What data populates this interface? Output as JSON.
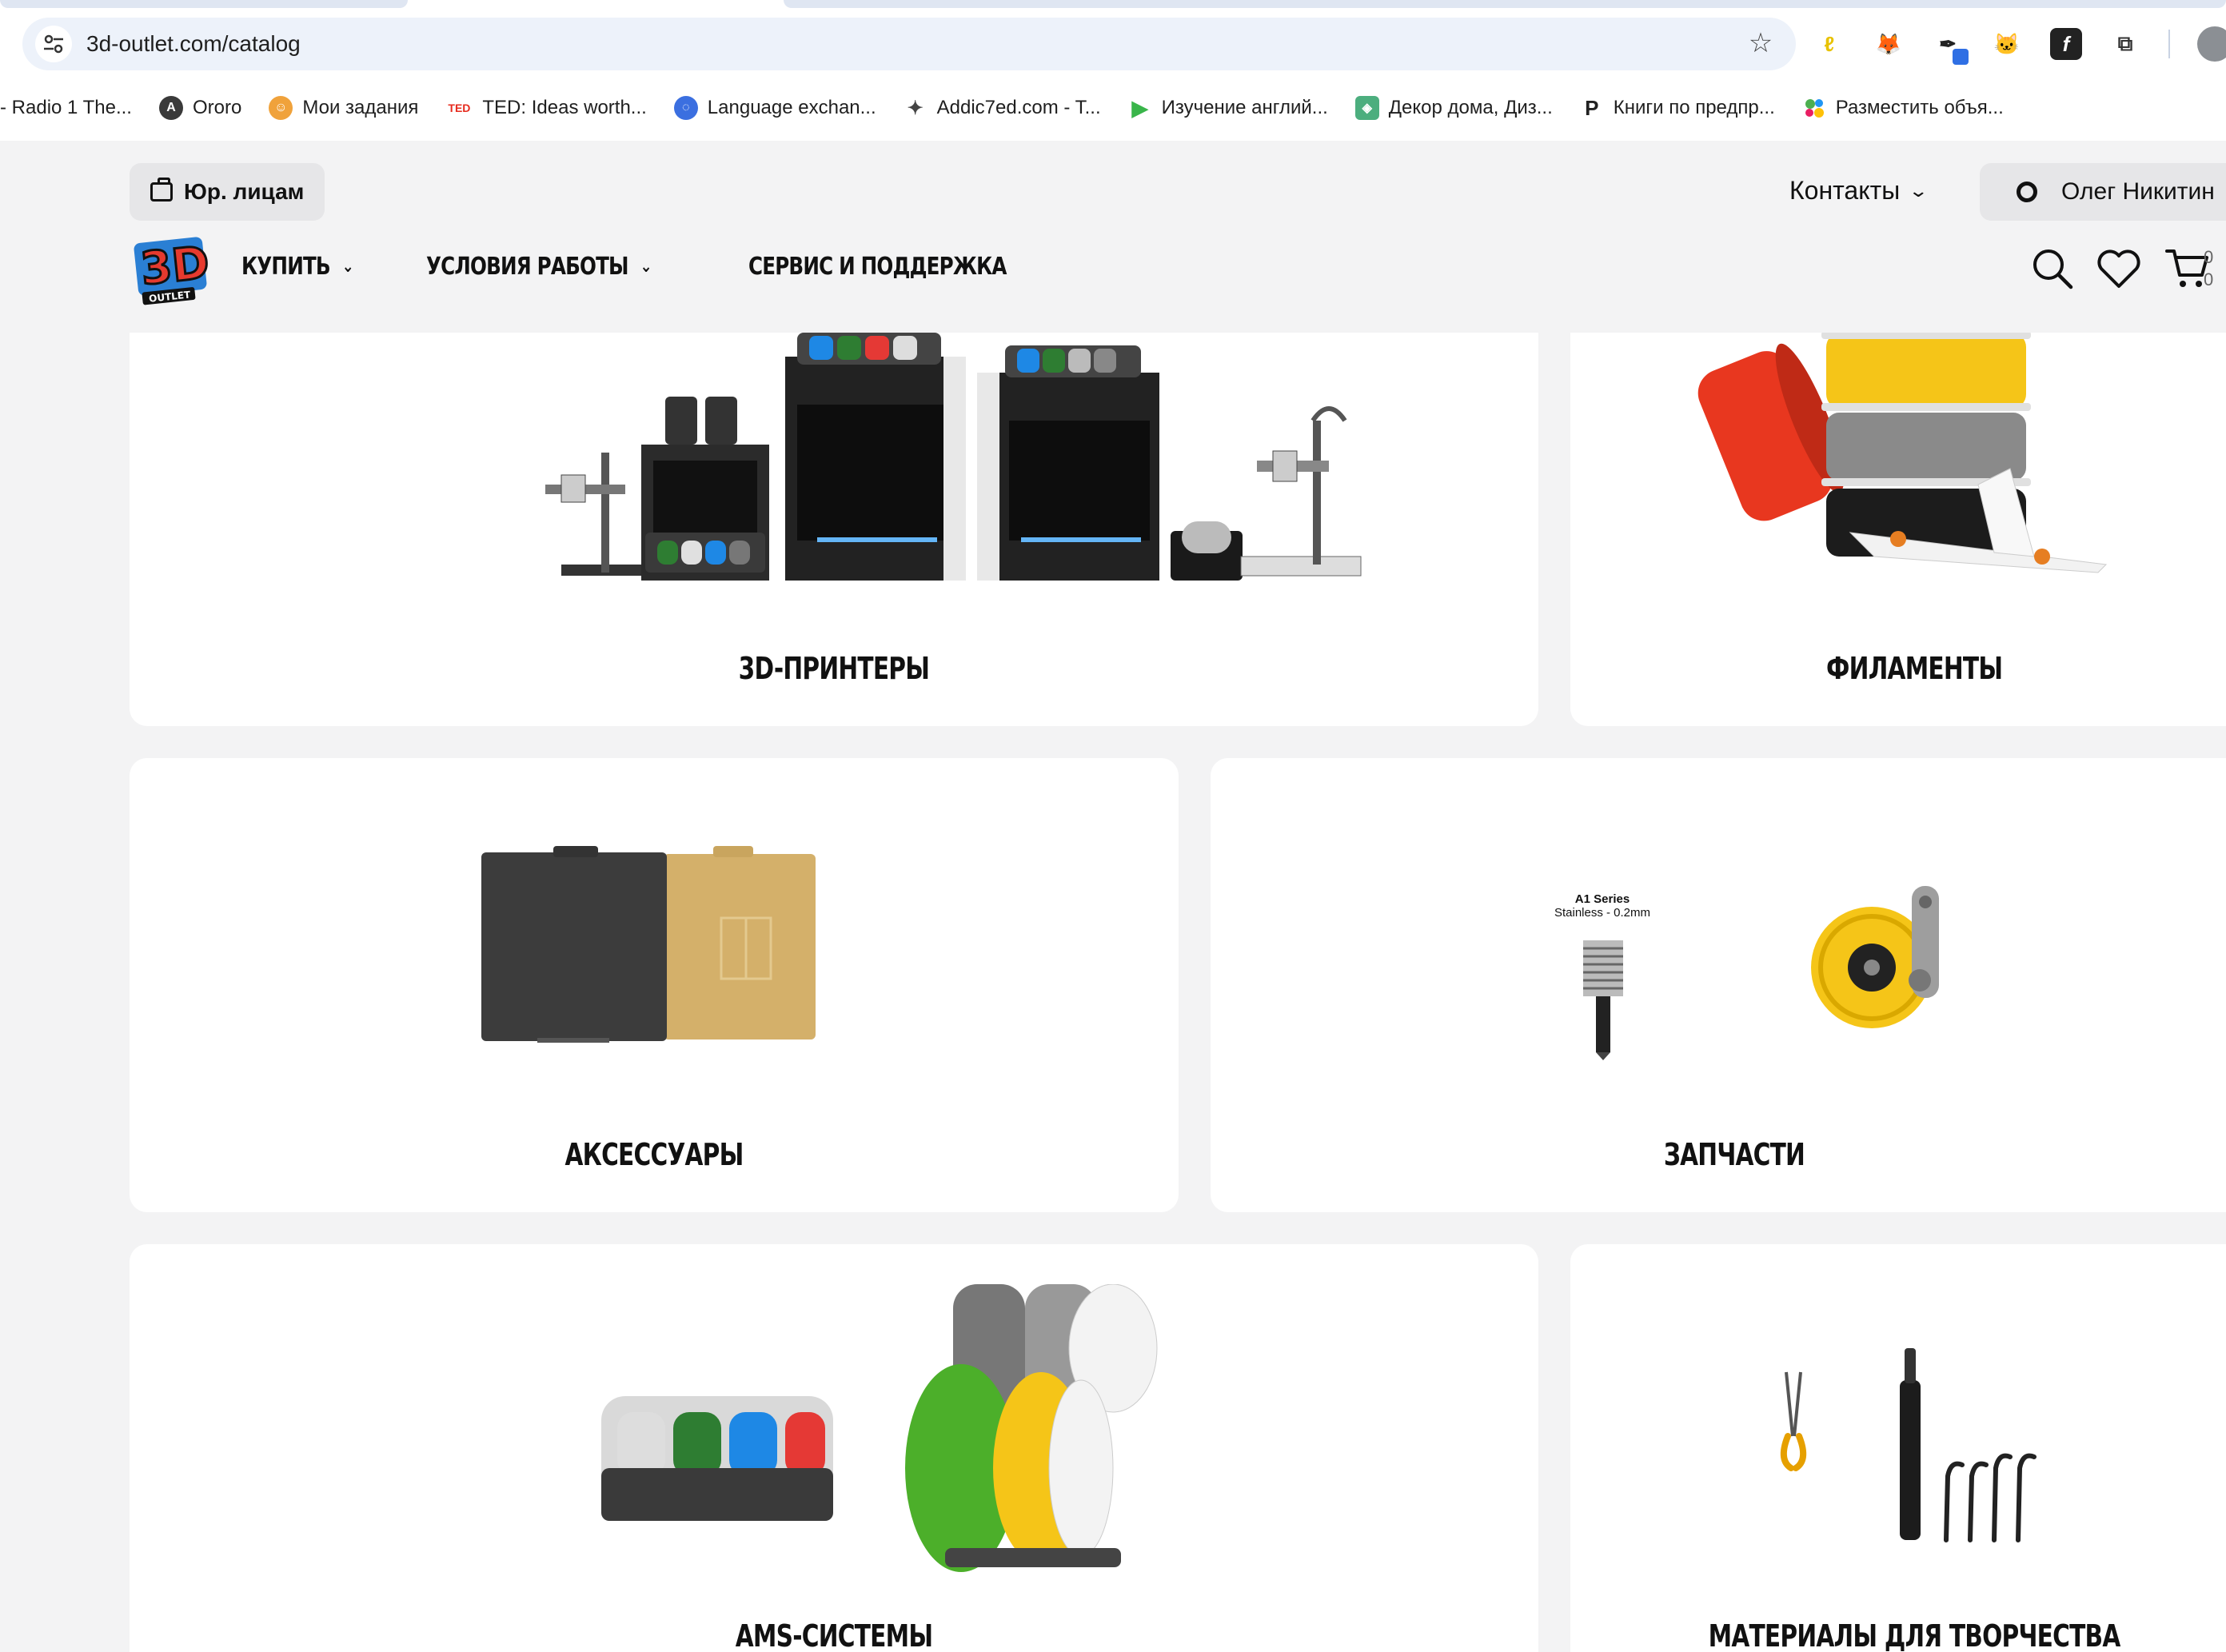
{
  "browser": {
    "url": "3d-outlet.com/catalog",
    "bookmarks": [
      {
        "label": "- Radio 1 The...",
        "fav_color": "transparent",
        "fav_glyph": ""
      },
      {
        "label": "Ororo",
        "fav_color": "#3a3a3a",
        "fav_glyph": "A"
      },
      {
        "label": "Мои задания",
        "fav_color": "#f0a23b",
        "fav_glyph": "☺"
      },
      {
        "label": "TED: Ideas worth...",
        "fav_color": "#e62b1e",
        "fav_glyph": "TED"
      },
      {
        "label": "Language exchan...",
        "fav_color": "#3b6fe0",
        "fav_glyph": "◌"
      },
      {
        "label": "Addic7ed.com - T...",
        "fav_color": "#555555",
        "fav_glyph": "✦"
      },
      {
        "label": "Изучение англий...",
        "fav_color": "#39b54a",
        "fav_glyph": "▶"
      },
      {
        "label": "Декор дома, Диз...",
        "fav_color": "#4cae7e",
        "fav_glyph": "◈"
      },
      {
        "label": "Книги по предпр...",
        "fav_color": "#222222",
        "fav_glyph": "P"
      },
      {
        "label": "Разместить объя...",
        "fav_color": "#e95c9c",
        "fav_glyph": "●"
      }
    ]
  },
  "header": {
    "b2b_label": "Юр. лицам",
    "contacts_label": "Контакты",
    "user_name": "Олег Никитин",
    "nav": [
      {
        "label": "КУПИТЬ",
        "has_dropdown": true
      },
      {
        "label": "УСЛОВИЯ РАБОТЫ",
        "has_dropdown": true
      },
      {
        "label": "СЕРВИС И ПОДДЕРЖКА",
        "has_dropdown": false
      }
    ],
    "cart_count_top": "0",
    "cart_count_bottom": "0"
  },
  "catalog": {
    "categories": [
      {
        "title": "3D-ПРИНТЕРЫ"
      },
      {
        "title": "ФИЛАМЕНТЫ"
      },
      {
        "title": "АКСЕССУАРЫ"
      },
      {
        "title": "ЗАПЧАСТИ"
      },
      {
        "title": "AMS-СИСТЕМЫ"
      },
      {
        "title": "МАТЕРИАЛЫ ДЛЯ ТВОРЧЕСТВА"
      }
    ],
    "parts_caption_line1": "A1 Series",
    "parts_caption_line2": "Stainless - 0.2mm"
  },
  "colors": {
    "page_bg": "#f3f3f4",
    "card_bg": "#ffffff",
    "logo_red": "#e63a2e",
    "logo_blue": "#2a7fd4",
    "filament_red": "#e8371f",
    "filament_yellow": "#f5c518",
    "filament_green": "#4caf2a",
    "gold_plate": "#d4b06a"
  }
}
